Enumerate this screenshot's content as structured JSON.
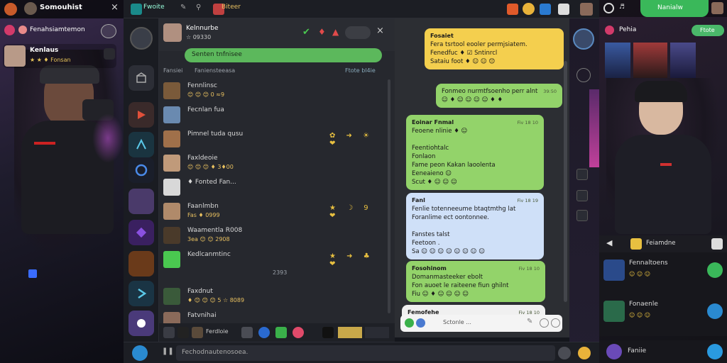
{
  "left": {
    "title": "Somouhist",
    "stream_label": "Fenahsiamtemon",
    "streamer_name": "Kenlaus",
    "streamer_sub": "★ ★ ♦ Fonsan",
    "close_symbol": "×"
  },
  "topbar": {
    "app_name": "Fwoite",
    "item2": "Biteer"
  },
  "chat": {
    "header_name": "Kelnnurbe",
    "header_sub": "☆ 09330",
    "filter_label": "Senten tnfnisee",
    "list_left": "Fansiei",
    "list_mid": "Faniensteeasa",
    "list_right": "Ftote bl4ie",
    "rows": [
      {
        "name": "Fennlinsc",
        "sub": "😊 😊 😊 0 ≈9",
        "icons": "",
        "time": ""
      },
      {
        "name": "Fecnlan fua",
        "sub": "",
        "icons": "",
        "time": ""
      },
      {
        "name": "Pimnel tuda qusu",
        "sub": "",
        "icons": "✿ ➜ ☀ ❤",
        "time": ""
      },
      {
        "name": "Faxldeoie",
        "sub": "😊 😊 😊 ♦ 3♦00",
        "icons": "",
        "time": ""
      },
      {
        "name": "♦ Fonted Fan...",
        "sub": "",
        "icons": "",
        "time": ""
      },
      {
        "name": "Faanlmbn",
        "sub": "Fas ♦ 0999",
        "icons": "★ ☽ 9 ❤",
        "time": ""
      },
      {
        "name": "Waamentla R008",
        "sub": "3ea 😊 😊 2908",
        "icons": "",
        "time": ""
      },
      {
        "name": "Kedlcanmtinc",
        "sub": "",
        "icons": "★ ➜ ♣ ❤",
        "time": "2393"
      },
      {
        "name": "Faxdnut",
        "sub": "♦ 😊 😊 😊 5 ☆ 8089",
        "icons": "",
        "time": ""
      },
      {
        "name": "Fatvnihai",
        "sub": "",
        "icons": "",
        "time": ""
      }
    ],
    "bottom_name": "Ferdloie"
  },
  "conversation": {
    "bubbles": [
      {
        "head": "Fosaiet",
        "time": "",
        "lines": [
          "Fera tsrtool eooler permjsiatem.",
          "Fenedfuc ♦ ☑ Sntinrcl",
          "Sataiu foot ♦ ☺ ☺ 😊"
        ],
        "color": "y"
      },
      {
        "head": "",
        "time": "39:50",
        "lines": [
          "Fonmeo nurmtfsoenho perr alnt",
          "☺ ♦ ☺ ☺ ☺ ☺ ♦ ♦"
        ],
        "color": "g"
      },
      {
        "head": "Eoinar Fnmal",
        "time": "Fiv 18 10",
        "lines": [
          "Feoene nlinie ♦ ☺",
          "",
          "Feentiohtalc",
          "Fonlaon",
          "Fame peon Kakan laoolenta",
          "Eeneaieno ☺",
          "Scut ♦ ☺ ☺ ☺"
        ],
        "color": "g"
      },
      {
        "head": "Fanl",
        "time": "Fiv 18 19",
        "lines": [
          "Fenlie totenneeume btaqtmthg lat",
          "Foranlime ect oontonnee.",
          "",
          "Fanstes talst",
          "Feetoon .",
          "Sa ☺ ☺ ☺ ☺ ☺ ☺ ☺ ☺"
        ],
        "color": "b"
      },
      {
        "head": "Fosohinom",
        "time": "Fiv 18 10",
        "lines": [
          "Domanmasteeker ebolt",
          "Fon auoet le raiteene fiun ghilnt",
          "Fiu ☺ ♦ ☺ ☺ ☺ ☺"
        ],
        "color": "g"
      },
      {
        "head": "Femofehe",
        "time": "Fiv 18 10",
        "lines": [],
        "color": "w"
      }
    ],
    "input_placeholder": "Sctonle ..."
  },
  "bottom": {
    "placeholder": "Fechodnautenosoea."
  },
  "right": {
    "title": "Nanialw",
    "sub_label": "Pehia",
    "sub_button": "Ftote",
    "game_tag": "Feiamdne",
    "list": [
      {
        "name": "Fennaltoens",
        "sub": "☺ ☺ ☺"
      },
      {
        "name": "Fonaenle",
        "sub": "☺ ☺ ☺"
      }
    ],
    "bottom_label": "Faniie"
  },
  "colors": {
    "accent_green": "#5cb85c",
    "bubble_yellow": "#f4cf4e",
    "bubble_green": "#93d36a",
    "bubble_blue": "#cfe0f8"
  }
}
